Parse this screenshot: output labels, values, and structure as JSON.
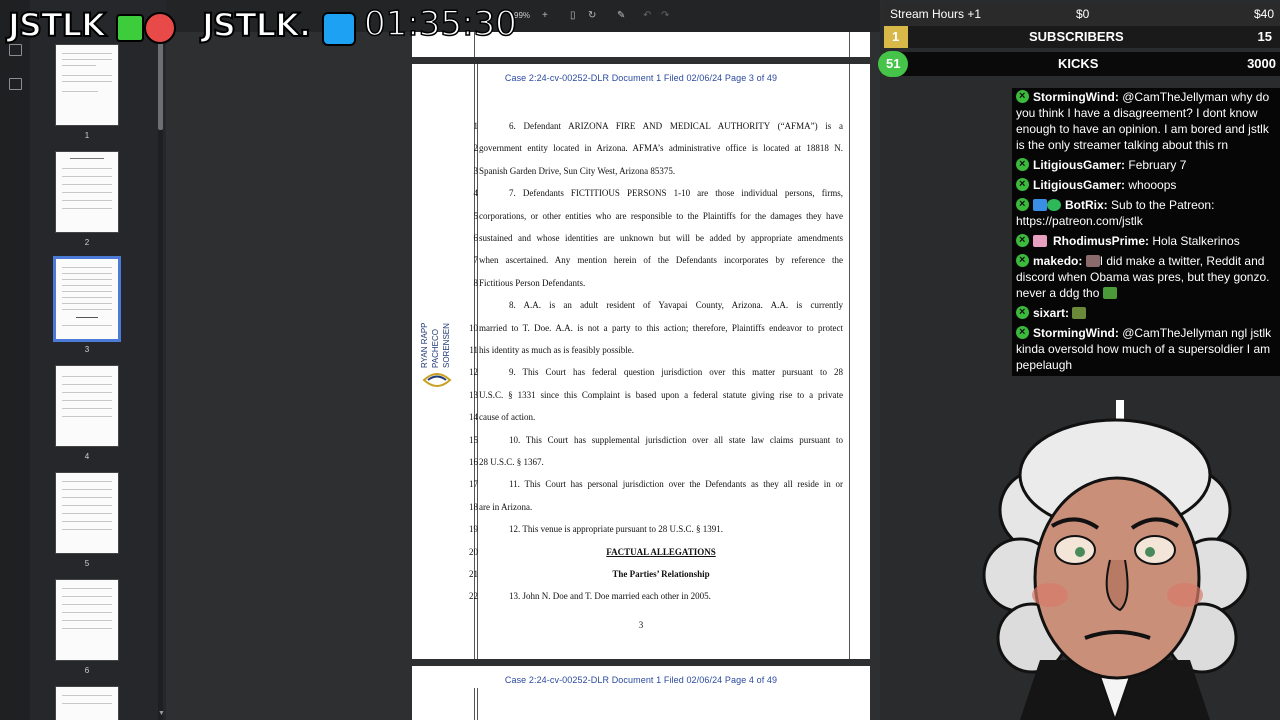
{
  "stream_overlay": {
    "logo_left": "JSTLK",
    "logo_right": "JSTLK.",
    "uptime": "01:35:30"
  },
  "goals": {
    "stream_hours": {
      "label": "Stream Hours +1",
      "start": "$0",
      "end": "$40"
    },
    "subscribers": {
      "count": "1",
      "label": "SUBSCRIBERS",
      "target": "15"
    },
    "kicks": {
      "count": "51",
      "label": "KICKS",
      "target": "3000"
    }
  },
  "viewer": {
    "zoom": "99%",
    "thumbnails": [
      {
        "num": "1"
      },
      {
        "num": "2"
      },
      {
        "num": "3",
        "selected": true
      },
      {
        "num": "4"
      },
      {
        "num": "5"
      },
      {
        "num": "6"
      }
    ]
  },
  "document": {
    "header": "Case 2:24-cv-00252-DLR    Document 1    Filed 02/06/24    Page 3 of 49",
    "next_header": "Case 2:24-cv-00252-DLR    Document 1    Filed 02/06/24    Page 4 of 49",
    "firm": [
      "RYAN RAPP",
      "PACHECO",
      "SORENSEN"
    ],
    "page_number": "3",
    "lines": [
      {
        "n": "1",
        "text": "6.      Defendant ARIZONA FIRE AND MEDICAL AUTHORITY (“AFMA”) is a"
      },
      {
        "n": "2",
        "text": "government entity located in Arizona. AFMA’s administrative office is located at 18818 N."
      },
      {
        "n": "3",
        "text": "Spanish Garden Drive, Sun City West, Arizona 85375."
      },
      {
        "n": "4",
        "text": "7.      Defendants FICTITIOUS PERSONS 1-10 are those individual persons, firms,"
      },
      {
        "n": "5",
        "text": "corporations, or other entities who are responsible to the Plaintiffs for the damages they have"
      },
      {
        "n": "6",
        "text": "sustained and whose identities are unknown but will be added by appropriate amendments"
      },
      {
        "n": "7",
        "text": "when ascertained. Any mention herein of the Defendants incorporates by reference the"
      },
      {
        "n": "8",
        "text": "Fictitious Person Defendants."
      },
      {
        "n": "",
        "text": "8.      A.A. is an adult resident of Yavapai County, Arizona. A.A. is currently"
      },
      {
        "n": "10",
        "text": "married to T. Doe. A.A. is not a party to this action; therefore, Plaintiffs endeavor to protect"
      },
      {
        "n": "11",
        "text": "his identity as much as is feasibly possible."
      },
      {
        "n": "12",
        "text": "9.      This Court has federal question jurisdiction over this matter pursuant to 28"
      },
      {
        "n": "13",
        "text": "U.S.C. § 1331 since this Complaint is based upon a federal statute giving rise to a private"
      },
      {
        "n": "14",
        "text": "cause of action."
      },
      {
        "n": "15",
        "text": "10.     This Court has supplemental jurisdiction over all state law claims pursuant to"
      },
      {
        "n": "16",
        "text": "28 U.S.C. § 1367."
      },
      {
        "n": "17",
        "text": "11.     This Court has personal jurisdiction over the Defendants as they all reside in or"
      },
      {
        "n": "18",
        "text": "are in Arizona."
      },
      {
        "n": "19",
        "text": "12.     This venue is appropriate pursuant to 28 U.S.C. § 1391."
      },
      {
        "n": "20",
        "text": "FACTUAL ALLEGATIONS"
      },
      {
        "n": "21",
        "text": "The Parties’ Relationship"
      },
      {
        "n": "22",
        "text": "13.     John N. Doe and T. Doe married each other in 2005."
      }
    ]
  },
  "chat": [
    {
      "user": "StormingWind:",
      "text": "@CamTheJellyman why do you think I have a disagreement? I dont know enough to have an opinion. I am bored and jstlk is the only streamer talking about this rn"
    },
    {
      "user": "LitigiousGamer:",
      "text": "February 7"
    },
    {
      "user": "LitigiousGamer:",
      "text": "whooops"
    },
    {
      "user": "BotRix:",
      "text": "Sub to the Patreon: https://patreon.com/jstlk"
    },
    {
      "user": "RhodimusPrime:",
      "text": "Hola Stalkerinos"
    },
    {
      "user": "makedo:",
      "text": "I did make a twitter, Reddit and discord when Obama was pres, but they gonzo. never a ddg tho"
    },
    {
      "user": "sixart:",
      "text": ""
    },
    {
      "user": "StormingWind:",
      "text": "@CamTheJellyman ngl jstlk kinda oversold how much of a supersoldier I am pepelaugh"
    }
  ]
}
